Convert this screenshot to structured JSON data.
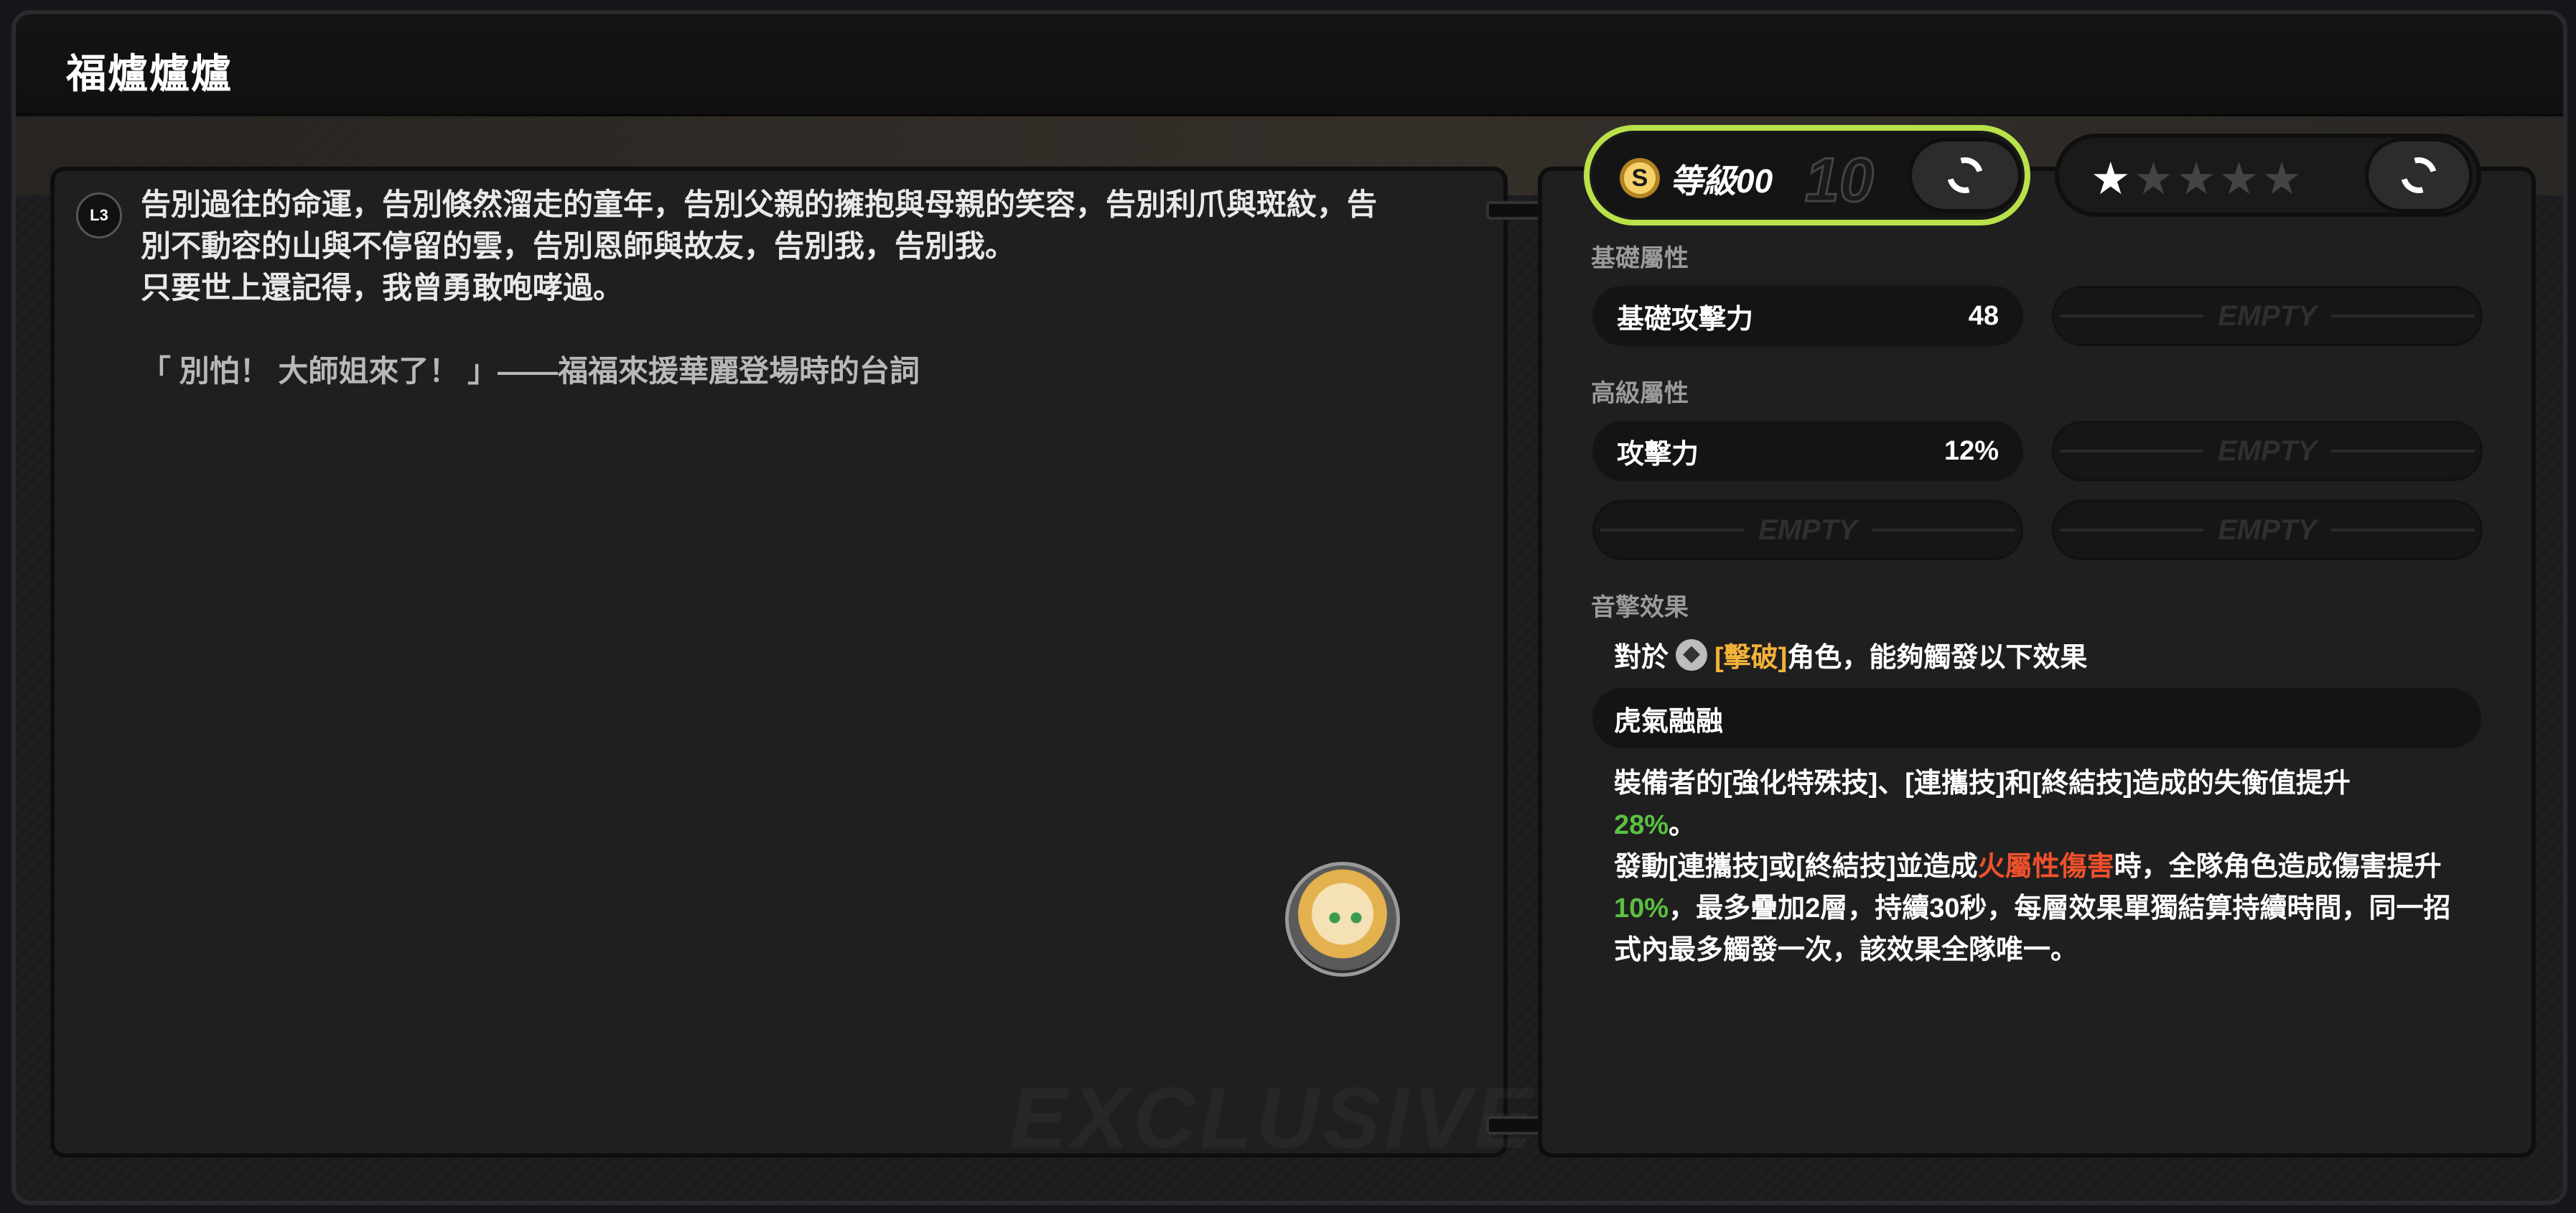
{
  "window": {
    "title": "福爐爐爐"
  },
  "story": {
    "level_badge": "L3",
    "line1": "告別過往的命運，告別倏然溜走的童年，告別父親的擁抱與母親的笑容，告別利爪與斑紋，告",
    "line2": "別不動容的山與不停留的雲，告別恩師與故友，告別我，告別我。",
    "line3": "只要世上還記得，我曾勇敢咆哮過。",
    "quote": "「 別怕！ 大師姐來了！ 」——福福來援華麗登場時的台詞",
    "watermark": "EXCLUSIVE"
  },
  "level": {
    "icon": "coin-S",
    "coin_letter": "S",
    "label": "等級00",
    "max": "10"
  },
  "stars": {
    "total": 5,
    "filled": 1
  },
  "base_attr": {
    "label": "基礎屬性",
    "stat_name": "基礎攻擊力",
    "stat_value": "48",
    "empty_text": "EMPTY"
  },
  "adv_attr": {
    "label": "高級屬性",
    "stat_name": "攻擊力",
    "stat_value": "12%",
    "empty_text": "EMPTY"
  },
  "effect": {
    "label": "音擎效果",
    "intro_prefix": "對於",
    "intro_tag": "[擊破]",
    "intro_suffix": "角色，能夠觸發以下效果",
    "name": "虎氣融融",
    "p1_a": "裝備者的[強化特殊技]、[連攜技]和[終結技]造成的失衡值提升",
    "p1_val": "28%",
    "p1_end": "。",
    "p2_a": "發動[連攜技]或[終結技]並造成",
    "p2_red": "火屬性傷害",
    "p2_b": "時，全隊角色造成傷害提升",
    "p2_val": "10%",
    "p2_c": "，最多疊加2層，持續30秒，每層效果單獨結算持續時間，同一招式內最多觸發一次，該效果全隊唯一。"
  },
  "colors": {
    "accent": "#b9e24a",
    "green": "#5ac142",
    "red": "#f0512c",
    "orange": "#f3b23a"
  }
}
